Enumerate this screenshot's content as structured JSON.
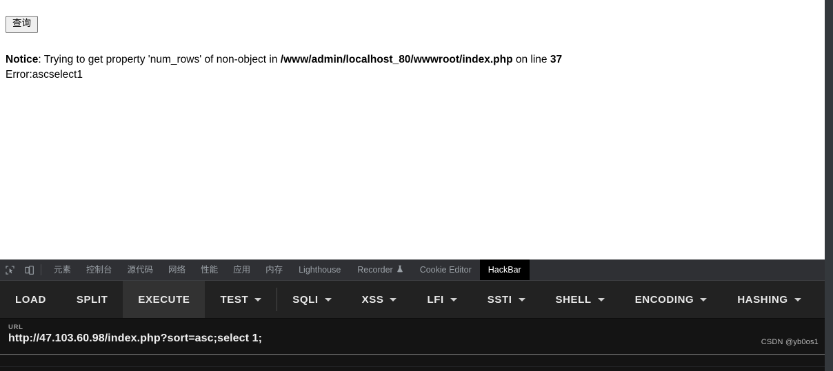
{
  "page": {
    "query_button_label": "查询",
    "notice": {
      "label": "Notice",
      "separator": ": ",
      "message": "Trying to get property 'num_rows' of non-object in ",
      "file_path": "/www/admin/localhost_80/wwwroot/index.php",
      "on_line_text": " on line ",
      "line_number": "37"
    },
    "error_line": "Error:ascselect1"
  },
  "devtools": {
    "icons": {
      "inspect": "inspect-element-icon",
      "device": "device-toolbar-icon"
    },
    "tabs": [
      {
        "label": "元素",
        "cjk": true,
        "active": false
      },
      {
        "label": "控制台",
        "cjk": true,
        "active": false
      },
      {
        "label": "源代码",
        "cjk": true,
        "active": false
      },
      {
        "label": "网络",
        "cjk": true,
        "active": false
      },
      {
        "label": "性能",
        "cjk": true,
        "active": false
      },
      {
        "label": "应用",
        "cjk": true,
        "active": false
      },
      {
        "label": "内存",
        "cjk": true,
        "active": false
      },
      {
        "label": "Lighthouse",
        "cjk": false,
        "active": false
      },
      {
        "label": "Recorder",
        "cjk": false,
        "active": false,
        "icon": "flask-icon"
      },
      {
        "label": "Cookie Editor",
        "cjk": false,
        "active": false
      },
      {
        "label": "HackBar",
        "cjk": false,
        "active": true
      }
    ]
  },
  "hackbar": {
    "buttons": [
      {
        "label": "LOAD",
        "caret": false,
        "highlight": false,
        "separator_before": false
      },
      {
        "label": "SPLIT",
        "caret": false,
        "highlight": false,
        "separator_before": false
      },
      {
        "label": "EXECUTE",
        "caret": false,
        "highlight": true,
        "separator_before": false
      },
      {
        "label": "TEST",
        "caret": true,
        "highlight": false,
        "separator_before": false
      },
      {
        "label": "SQLI",
        "caret": true,
        "highlight": false,
        "separator_before": true
      },
      {
        "label": "XSS",
        "caret": true,
        "highlight": false,
        "separator_before": false
      },
      {
        "label": "LFI",
        "caret": true,
        "highlight": false,
        "separator_before": false
      },
      {
        "label": "SSTI",
        "caret": true,
        "highlight": false,
        "separator_before": false
      },
      {
        "label": "SHELL",
        "caret": true,
        "highlight": false,
        "separator_before": false
      },
      {
        "label": "ENCODING",
        "caret": true,
        "highlight": false,
        "separator_before": false
      },
      {
        "label": "HASHING",
        "caret": true,
        "highlight": false,
        "separator_before": false
      }
    ],
    "url_field": {
      "label": "URL",
      "value": "http://47.103.60.98/index.php?sort=asc;select 1;"
    }
  },
  "watermark": "CSDN @yb0os1",
  "colors": {
    "page_background": "#ffffff",
    "devtools_tabbar": "#2f3034",
    "hackbar_toolbar": "#222222",
    "hackbar_url_panel": "#141414",
    "active_tab": "#000000",
    "highlight_button": "#323232",
    "scrollbar_strip": "#34383c"
  }
}
